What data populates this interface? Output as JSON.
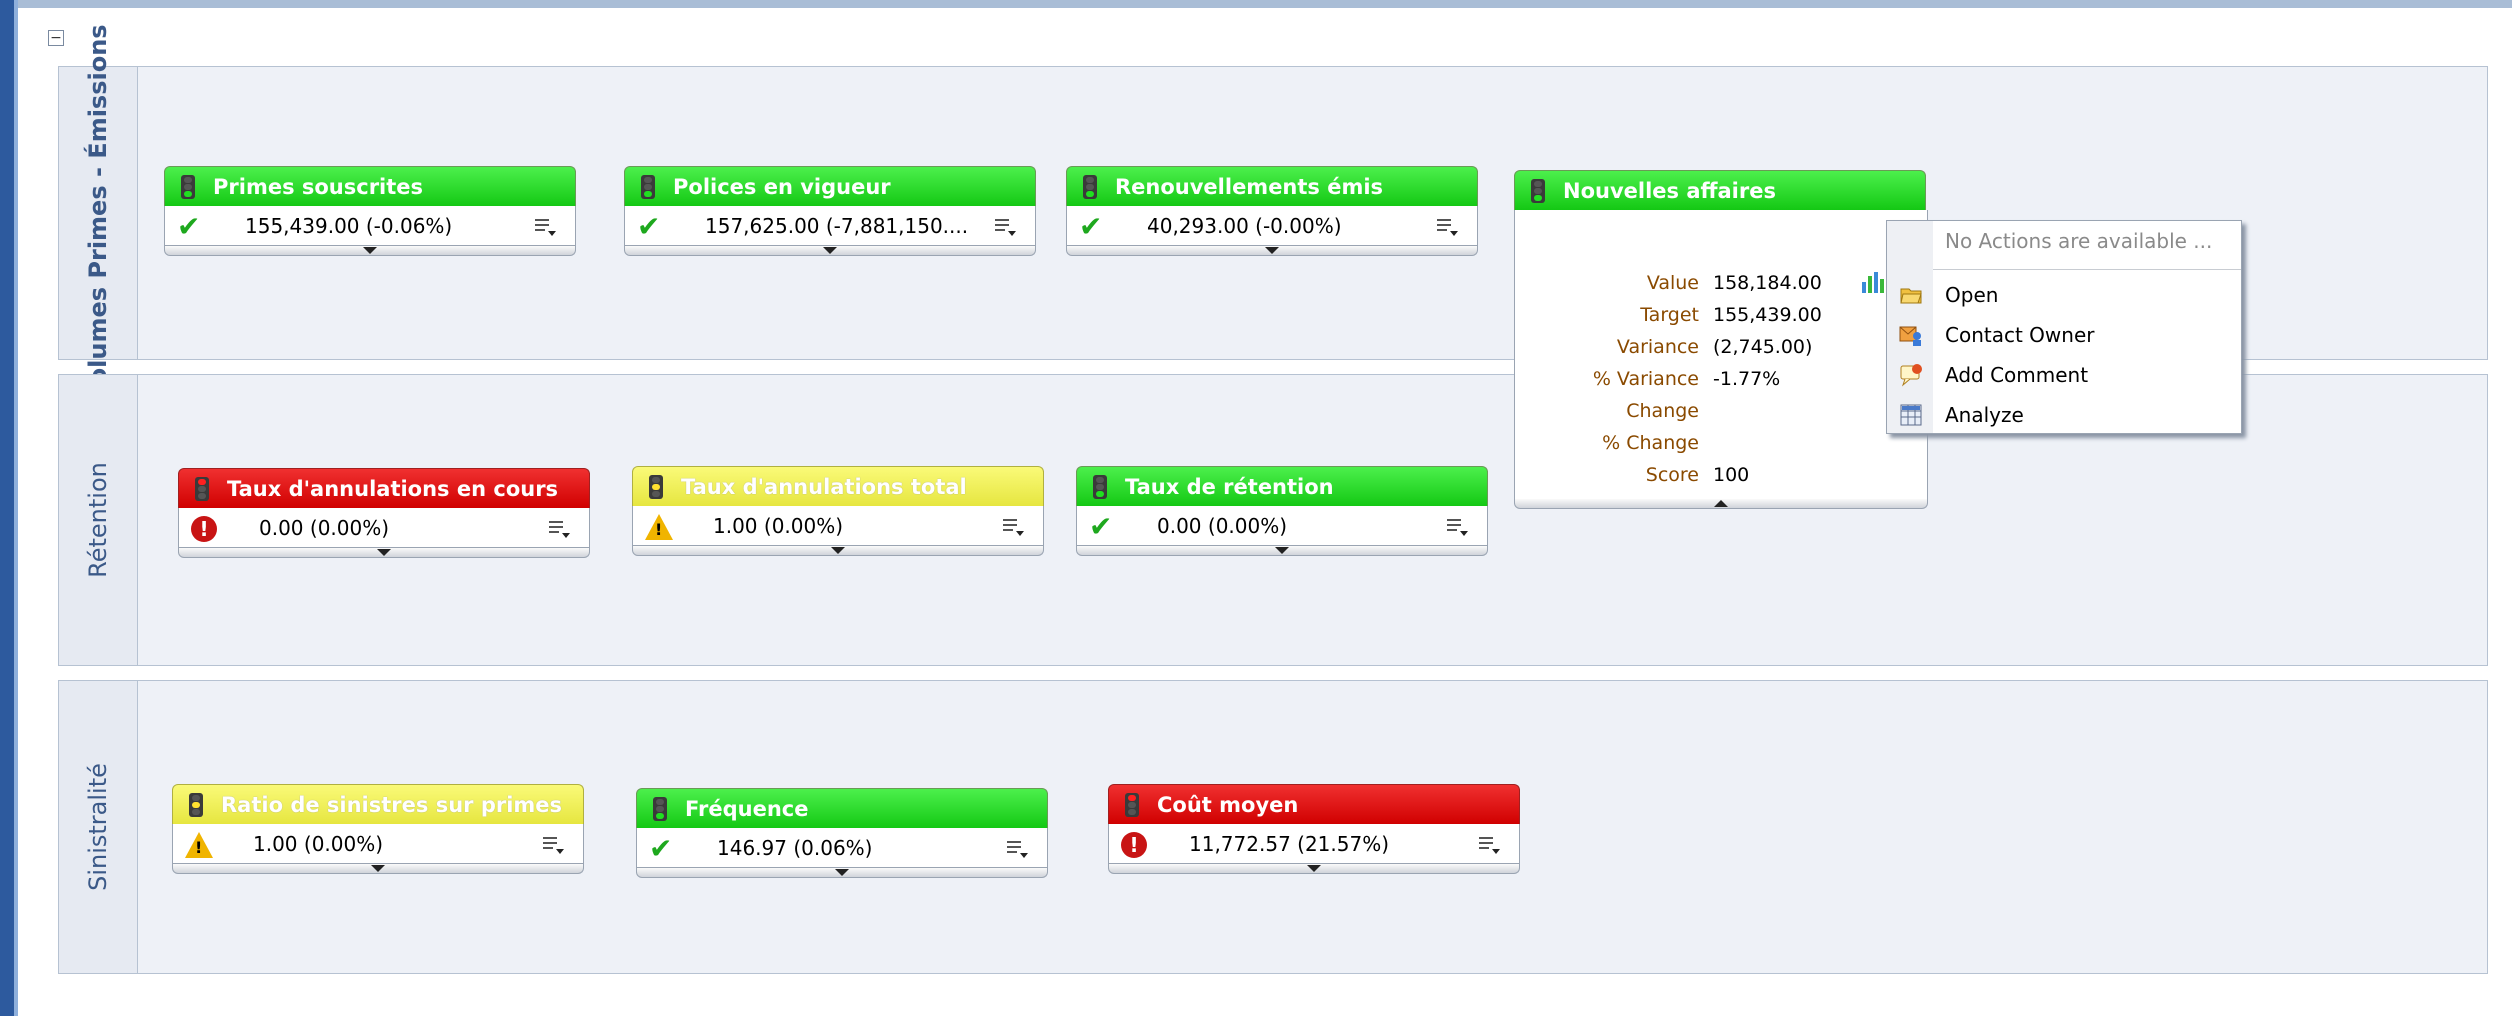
{
  "sections": [
    {
      "label": "Volumes Primes - Émissions"
    },
    {
      "label": "Rétention"
    },
    {
      "label": "Sinistralité"
    }
  ],
  "kpis": [
    {
      "title": "Primes souscrites",
      "value": "155,439.00 (-0.06%)",
      "color": "green",
      "status": "ok"
    },
    {
      "title": "Polices en vigueur",
      "value": "157,625.00 (-7,881,150....",
      "color": "green",
      "status": "ok"
    },
    {
      "title": "Renouvellements émis",
      "value": "40,293.00 (-0.00%)",
      "color": "green",
      "status": "ok"
    },
    {
      "title": "Nouvelles affaires",
      "value": "158,184.00 (-1.77%)",
      "color": "green",
      "status": "ok"
    },
    {
      "title": "Taux d'annulations en cours",
      "value": "0.00 (0.00%)",
      "color": "red",
      "status": "critical"
    },
    {
      "title": "Taux d'annulations total",
      "value": "1.00 (0.00%)",
      "color": "yellow",
      "status": "warning"
    },
    {
      "title": "Taux de rétention",
      "value": "0.00 (0.00%)",
      "color": "green",
      "status": "ok"
    },
    {
      "title": "Ratio de sinistres sur primes",
      "value": "1.00 (0.00%)",
      "color": "yellow",
      "status": "warning"
    },
    {
      "title": "Fréquence",
      "value": "146.97 (0.06%)",
      "color": "green",
      "status": "ok"
    },
    {
      "title": "Coût moyen",
      "value": "11,772.57 (21.57%)",
      "color": "red",
      "status": "critical"
    }
  ],
  "detail": {
    "rows": [
      {
        "label": "Value",
        "value": "158,184.00"
      },
      {
        "label": "Target",
        "value": "155,439.00"
      },
      {
        "label": "Variance",
        "value": "(2,745.00)"
      },
      {
        "label": "% Variance",
        "value": "-1.77%"
      },
      {
        "label": "Change",
        "value": ""
      },
      {
        "label": "% Change",
        "value": ""
      },
      {
        "label": "Score",
        "value": "100"
      }
    ]
  },
  "context_menu": {
    "header": "No Actions are available ...",
    "items": [
      {
        "label": "Open",
        "icon": "folder-open-icon"
      },
      {
        "label": "Contact Owner",
        "icon": "contact-owner-icon"
      },
      {
        "label": "Add Comment",
        "icon": "add-comment-icon"
      },
      {
        "label": "Analyze",
        "icon": "analyze-icon"
      }
    ]
  },
  "colors": {
    "green": "#22d022",
    "red": "#e01010",
    "yellow": "#eeee5a",
    "accent": "#2d5a9e"
  }
}
